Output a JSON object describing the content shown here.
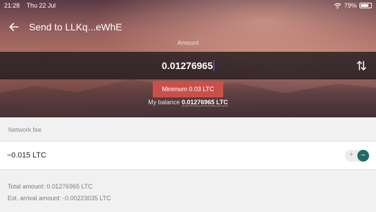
{
  "status": {
    "time": "21:28",
    "date": "Thu 22 Jul",
    "battery": "79%"
  },
  "header": {
    "title": "Send to LLKq...eWhE"
  },
  "amount": {
    "label": "Amount",
    "value": "0.01276965",
    "minimum": "Minimum 0.03 LTC",
    "balance_label": "My balance",
    "balance_value": "0.01276965 LTC"
  },
  "fee": {
    "section_label": "Network fee",
    "value": "−0.015 LTC",
    "plus": "+",
    "minus": "−"
  },
  "summary": {
    "total": "Total amount: 0.01276965 LTC",
    "arrival": "Est. arrival amount: -0.00223035 LTC"
  },
  "colors": {
    "accent": "#1f6d63",
    "warning": "#c9504a"
  }
}
